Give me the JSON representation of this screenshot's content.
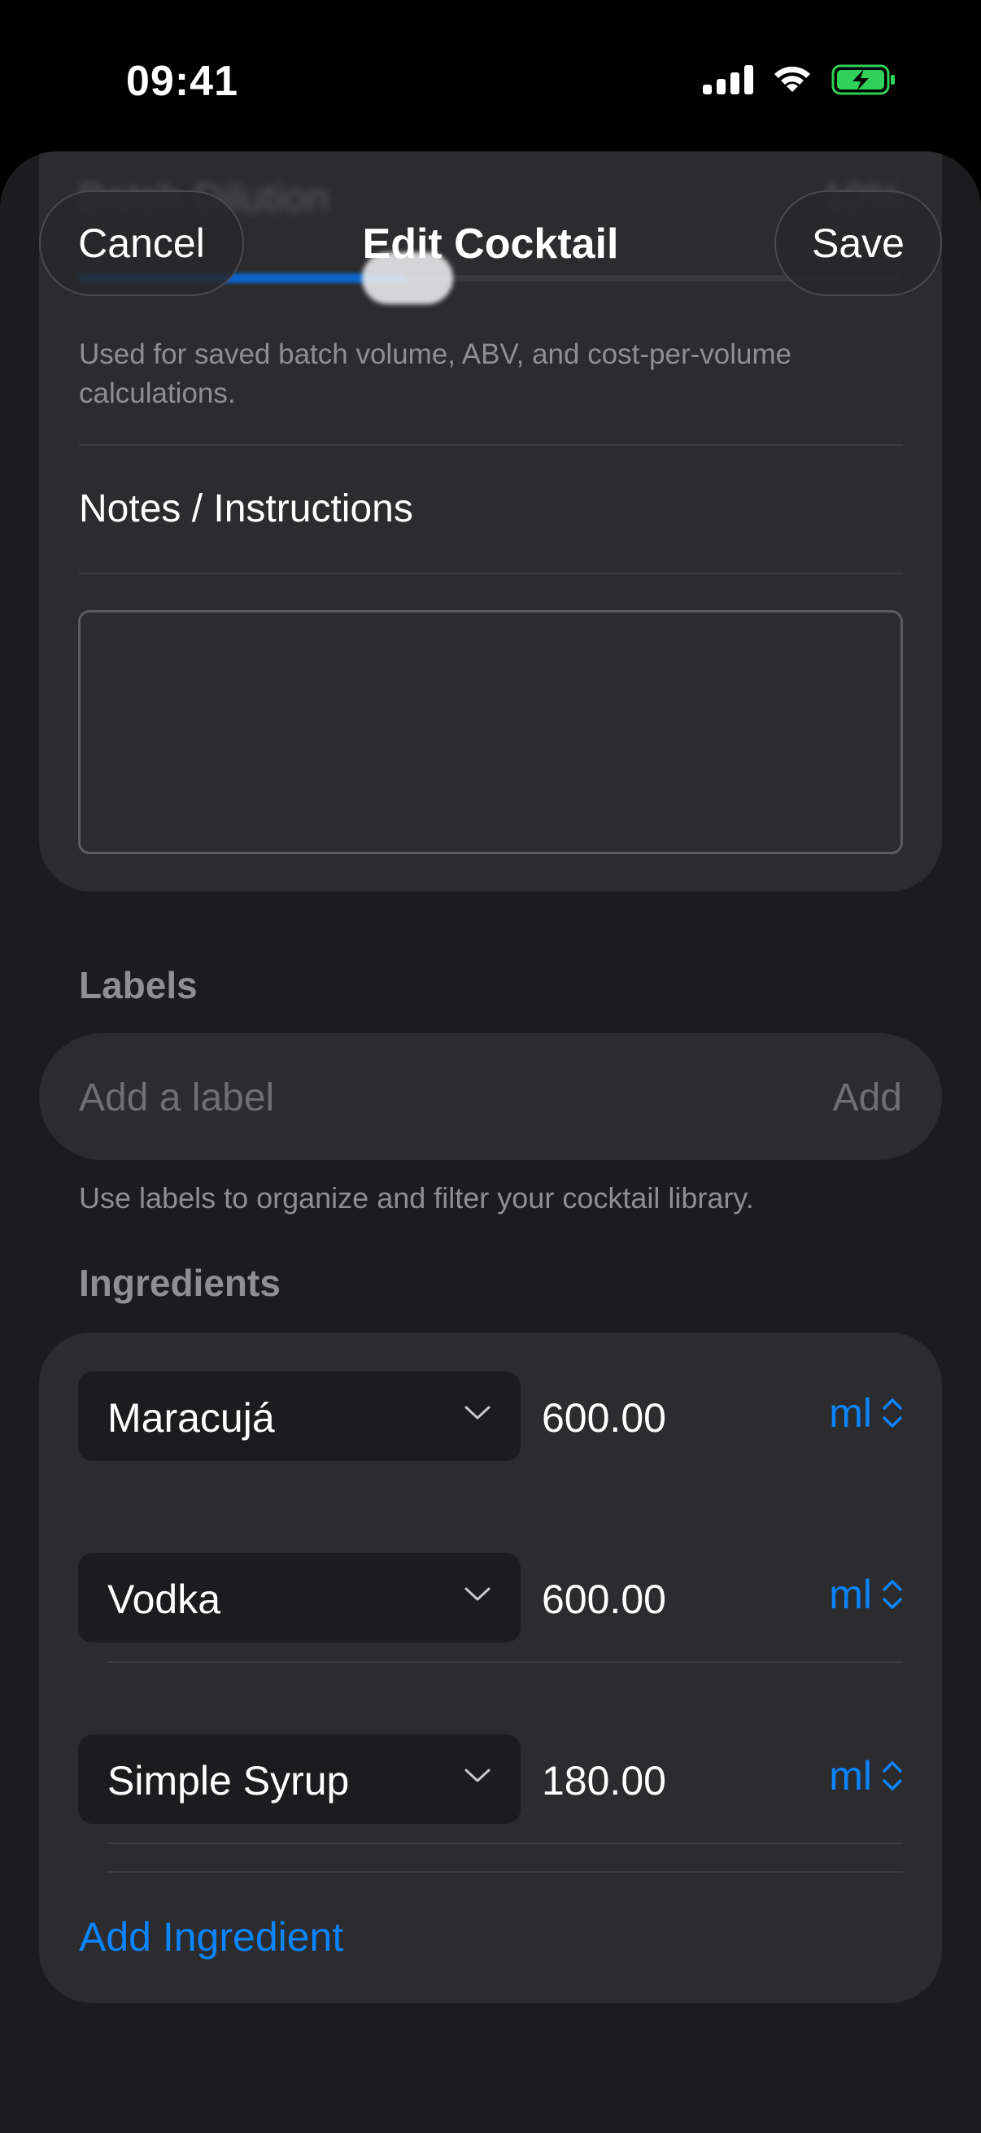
{
  "status_bar": {
    "time": "09:41"
  },
  "nav": {
    "cancel_label": "Cancel",
    "title": "Edit Cocktail",
    "save_label": "Save"
  },
  "batch": {
    "dilution_label": "Batch Dilution",
    "dilution_value": "10%",
    "slider_fraction": 0.4,
    "footnote": "Used for saved batch volume, ABV, and cost-per-volume calculations."
  },
  "notes": {
    "label": "Notes / Instructions",
    "value": ""
  },
  "labels": {
    "header": "Labels",
    "placeholder": "Add a label",
    "add_label": "Add",
    "footnote": "Use labels to organize and filter your cocktail library."
  },
  "ingredients": {
    "header": "Ingredients",
    "items": [
      {
        "name": "Maracujá",
        "amount": "600.00",
        "unit": "ml"
      },
      {
        "name": "Vodka",
        "amount": "600.00",
        "unit": "ml"
      },
      {
        "name": "Simple Syrup",
        "amount": "180.00",
        "unit": "ml"
      }
    ],
    "add_label": "Add Ingredient"
  },
  "colors": {
    "accent": "#0a84ff",
    "background": "#1c1c1e",
    "card": "#2c2c2e",
    "battery": "#30d158"
  },
  "icons": [
    "cellular-signal-icon",
    "wifi-icon",
    "battery-charging-icon",
    "chevron-down-icon",
    "up-down-chevron-icon"
  ]
}
